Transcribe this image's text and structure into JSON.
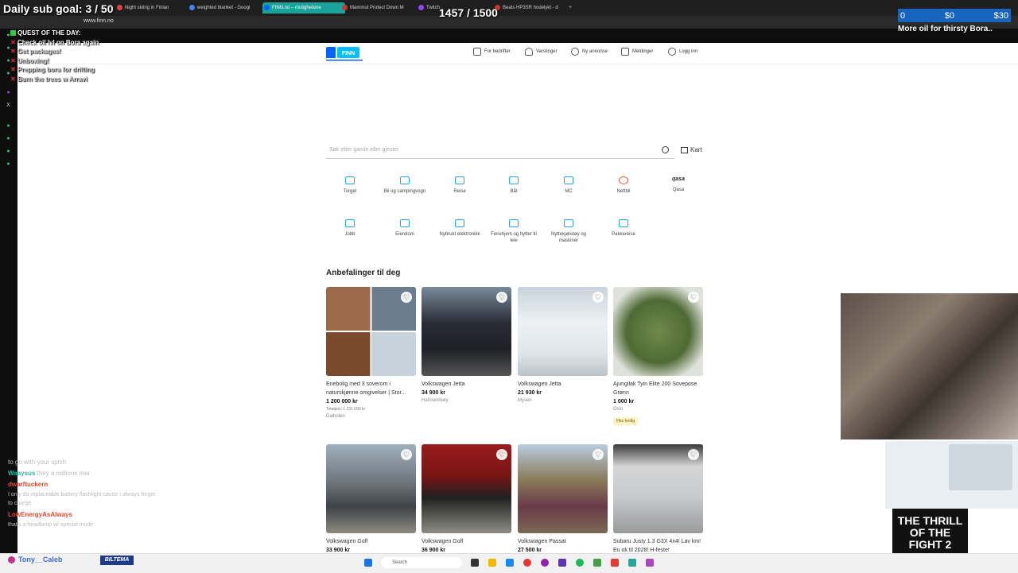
{
  "browser": {
    "tabs": [
      {
        "label": "Night skiing in Finlan",
        "color": "#d44"
      },
      {
        "label": "weighted blanket - Googl",
        "color": "#4285f4"
      },
      {
        "label": "FINN.no – mulighetene",
        "color": "#0063fb",
        "active": true
      },
      {
        "label": "Mammut Protect Down M",
        "color": "#c33"
      },
      {
        "label": "Twitch",
        "color": "#9146ff"
      },
      {
        "label": "Beats HP3SR hodelykt - d",
        "color": "#c33"
      }
    ],
    "url": "www.finn.no"
  },
  "overlay": {
    "sub_goal": "Daily sub goal: 3 / 50",
    "counter": "1457 / 1500",
    "quest_title": "QUEST OF THE DAY:",
    "quests": [
      {
        "text": "Check oil lvl on Bora again",
        "done": false
      },
      {
        "text": "Get packages!",
        "done": false
      },
      {
        "text": "Unboxing!",
        "done": false
      },
      {
        "text": "Prepping bora for drifting",
        "done": false
      },
      {
        "text": "Burn the trees w Arravi",
        "done": false
      }
    ],
    "money": [
      "0",
      "$0",
      "$30"
    ],
    "oil_text": "More oil for thirsty Bora..",
    "thrill_text": "THE THRILL OF THE FIGHT 2",
    "chat": [
      {
        "user": "",
        "text": "to go with your splsh",
        "color": "#bbb"
      },
      {
        "user": "Waaysus",
        "text": "they a millions mer",
        "color": "#2fb9a5"
      },
      {
        "user": "dwarftuckern",
        "text": "I only do replaceable battery flashlight cause I always forget to charge",
        "color": "#e24a2e"
      },
      {
        "user": "LowEnergyAsAlways",
        "text": "that's a headlamp w/ special mode",
        "color": "#e24a2e"
      }
    ],
    "streamer": "Tony__Caleb",
    "sponsor": "BILTEMA"
  },
  "finn": {
    "nav": [
      "For bedrifter",
      "Varslinger",
      "Ny annonse",
      "Meldinger",
      "Logg inn"
    ],
    "search_placeholder": "Søk etter gamle eller gjester",
    "map_label": "Kart",
    "categories": [
      "Torget",
      "Bil og campingvogn",
      "Reise",
      "Båt",
      "MC",
      "Nettbil",
      "Qasa",
      "Jobb",
      "Eiendom",
      "Nybrukt elektronikk",
      "Feriehjem og hytter til leie",
      "Nyttekjøretøy og maskiner",
      "Pakkereise"
    ],
    "qasa_logo": "qasa",
    "recs_title": "Anbefalinger til deg",
    "cards": [
      {
        "title": "Enebolig med 3 soverom i naturskjønne omgivelser | Stor...",
        "price": "1 200 000 kr",
        "sub": "Totalpris: 1 231 090 kr",
        "loc": "Dalholen"
      },
      {
        "title": "Volkswagen Jetta",
        "price": "34 900 kr",
        "sub": "",
        "loc": "Hafslundsøy"
      },
      {
        "title": "Volkswagen Jetta",
        "price": "21 930 kr",
        "sub": "",
        "loc": "Mysen"
      },
      {
        "title": "Ajungilak Tyin Elite 200 Sovepose Grønn",
        "price": "1 000 kr",
        "sub": "",
        "loc": "Oslo",
        "badge": "Fiks ferdig"
      },
      {
        "title": "Volkswagen Golf",
        "price": "33 900 kr",
        "sub": "",
        "loc": ""
      },
      {
        "title": "Volkswagen Golf",
        "price": "36 900 kr",
        "sub": "",
        "loc": ""
      },
      {
        "title": "Volkswagen Passat",
        "price": "27 500 kr",
        "sub": "",
        "loc": ""
      },
      {
        "title": "Subaru Justy 1.3 G3X 4x4! Lav km! Eu ok til 2028! H-feste!",
        "price": "",
        "sub": "",
        "loc": ""
      }
    ]
  },
  "taskbar": {
    "search": "Search"
  }
}
